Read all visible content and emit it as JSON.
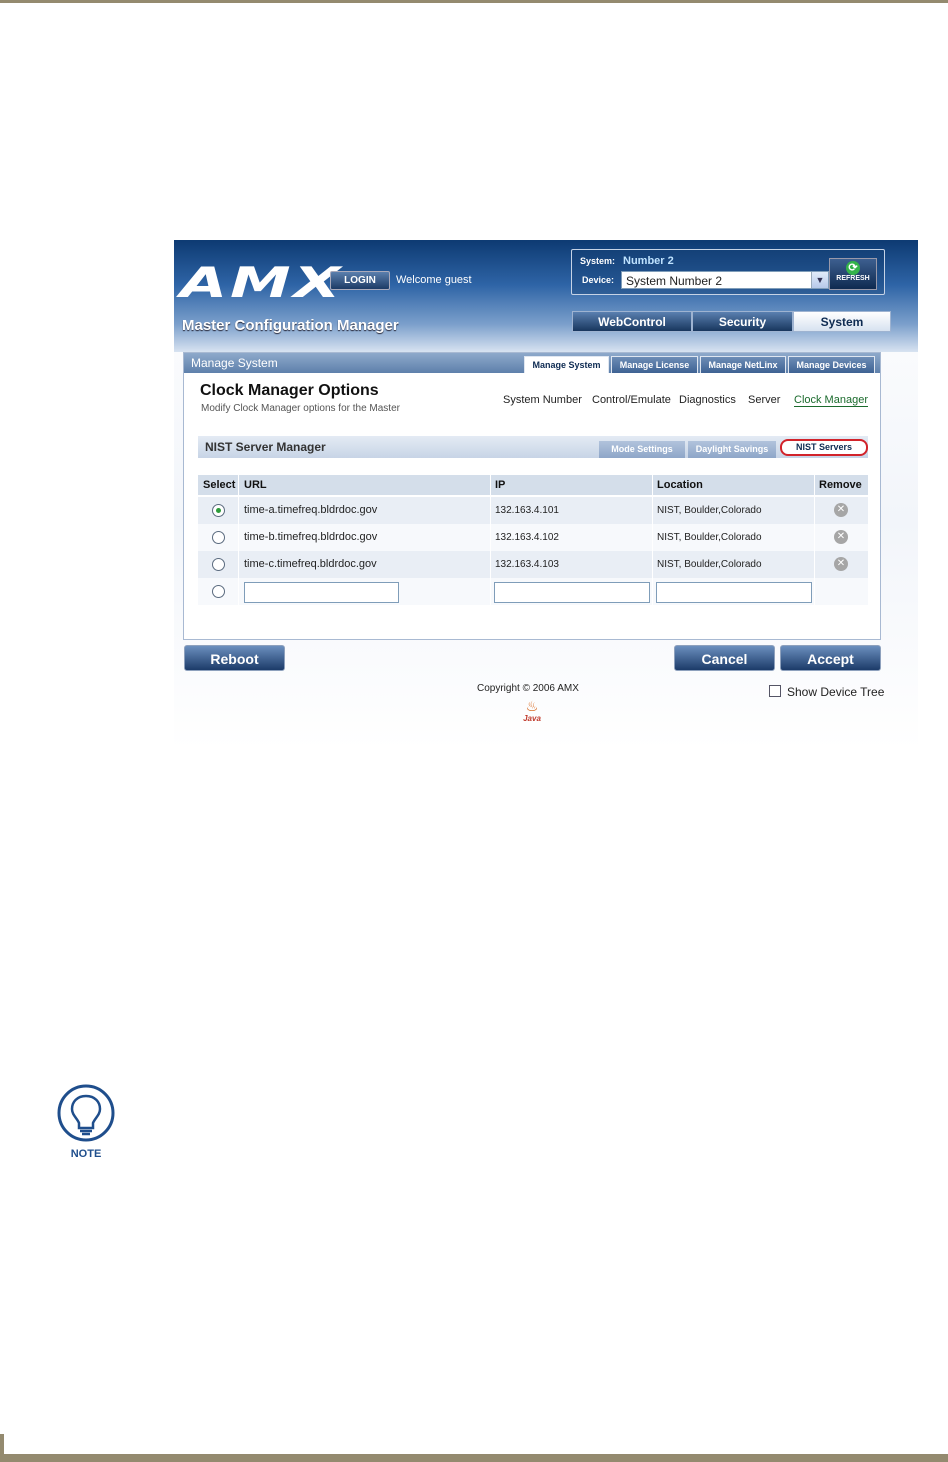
{
  "header": {
    "logo": "AMX",
    "login_label": "LOGIN",
    "welcome": "Welcome guest",
    "app_title": "Master Configuration Manager",
    "system_label": "System:",
    "system_value": "Number 2",
    "device_label": "Device:",
    "device_selected": "System Number 2",
    "refresh_label": "REFRESH"
  },
  "main_tabs": [
    {
      "label": "WebControl"
    },
    {
      "label": "Security"
    },
    {
      "label": "System"
    }
  ],
  "panel": {
    "title": "Manage System",
    "tabs": [
      {
        "label": "Manage System"
      },
      {
        "label": "Manage License"
      },
      {
        "label": "Manage NetLinx"
      },
      {
        "label": "Manage Devices"
      }
    ],
    "options_title": "Clock Manager Options",
    "options_subtitle": "Modify Clock Manager options for the Master",
    "links": [
      {
        "label": "System Number"
      },
      {
        "label": "Control/Emulate"
      },
      {
        "label": "Diagnostics"
      },
      {
        "label": "Server"
      },
      {
        "label": "Clock Manager"
      }
    ]
  },
  "nist": {
    "title": "NIST Server Manager",
    "tabs": [
      {
        "label": "Mode Settings"
      },
      {
        "label": "Daylight Savings"
      },
      {
        "label": "NIST Servers"
      }
    ],
    "columns": [
      "Select",
      "URL",
      "IP",
      "Location",
      "Remove"
    ],
    "rows": [
      {
        "url": "time-a.timefreq.bldrdoc.gov",
        "ip": "132.163.4.101",
        "location": "NIST, Boulder,Colorado",
        "selected": true
      },
      {
        "url": "time-b.timefreq.bldrdoc.gov",
        "ip": "132.163.4.102",
        "location": "NIST, Boulder,Colorado",
        "selected": false
      },
      {
        "url": "time-c.timefreq.bldrdoc.gov",
        "ip": "132.163.4.103",
        "location": "NIST, Boulder,Colorado",
        "selected": false
      }
    ]
  },
  "buttons": {
    "reboot": "Reboot",
    "cancel": "Cancel",
    "accept": "Accept"
  },
  "footer": {
    "copyright": "Copyright © 2006 AMX",
    "java": "Java",
    "show_device_tree": "Show Device Tree"
  },
  "note_label": "NOTE",
  "colors": {
    "accent_dark": "#18365e",
    "highlight_red": "#d2232a",
    "active_link_green": "#1b6b2d",
    "page_rule": "#948a6f"
  }
}
